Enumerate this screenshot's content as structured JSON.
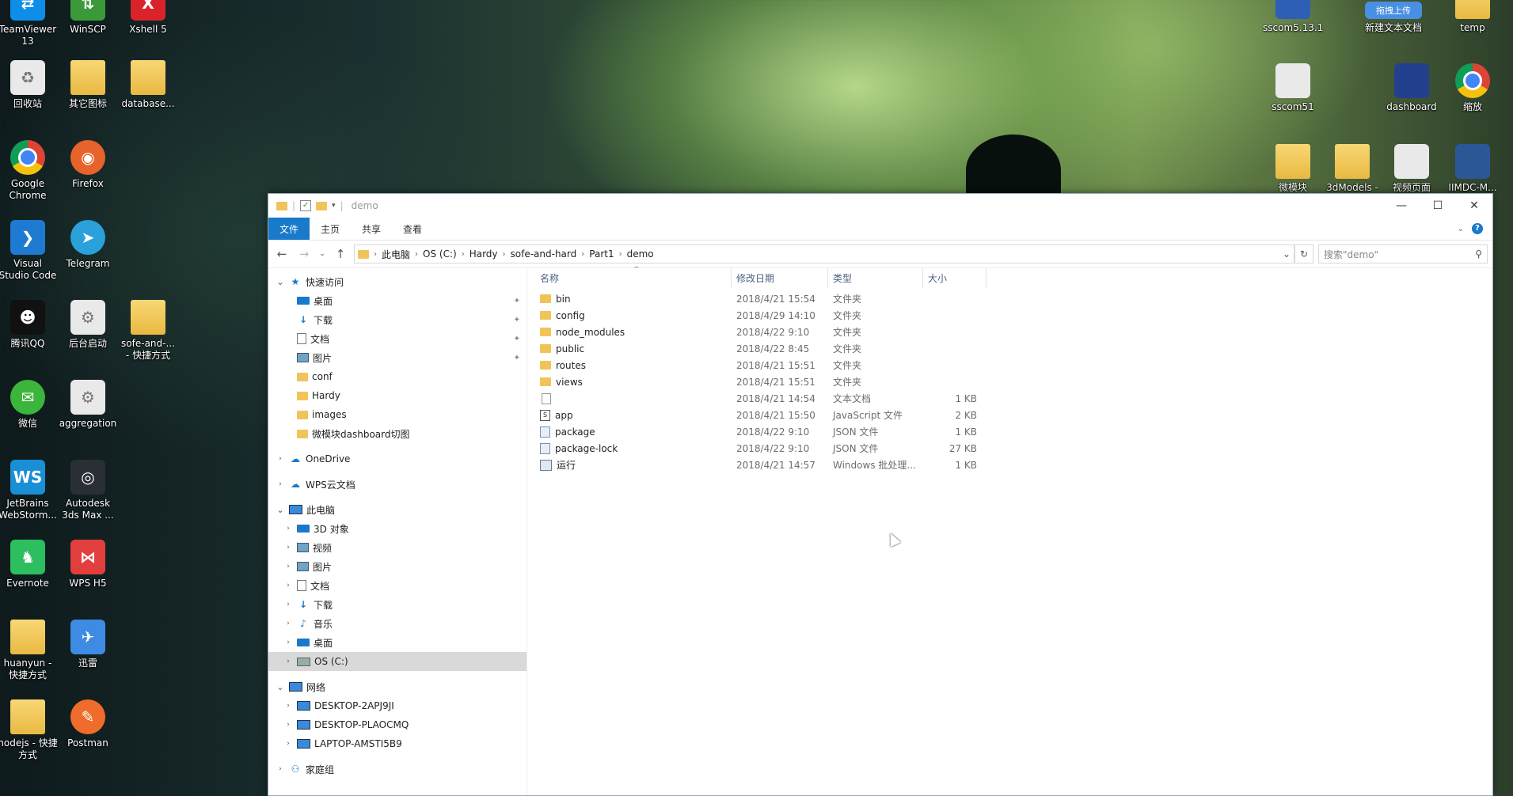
{
  "desktop_left": [
    {
      "label": "TeamViewer 13",
      "icon": "teamviewer-icon",
      "kind": "blue",
      "glyph": "⇄",
      "color": "#0e8ee9"
    },
    {
      "label": "WinSCP",
      "icon": "winscp-icon",
      "kind": "green",
      "glyph": "⇅",
      "color": "#3a9a3a"
    },
    {
      "label": "Xshell 5",
      "icon": "xshell-icon",
      "kind": "red",
      "glyph": "X",
      "color": "#d9232b"
    },
    {
      "label": "回收站",
      "icon": "recycle-bin-icon",
      "kind": "doc",
      "glyph": "♻",
      "color": "#e9e9e9"
    },
    {
      "label": "其它图标",
      "icon": "folder-icon",
      "kind": "folder",
      "glyph": "",
      "color": "#f1c35b"
    },
    {
      "label": "database...",
      "icon": "folder-icon",
      "kind": "folder",
      "glyph": "",
      "color": "#f1c35b"
    },
    {
      "label": "Google Chrome",
      "icon": "chrome-icon",
      "kind": "chrome",
      "glyph": "",
      "color": ""
    },
    {
      "label": "Firefox",
      "icon": "firefox-icon",
      "kind": "ff",
      "glyph": "◉",
      "color": "#e8622b"
    },
    {
      "label": "Visual Studio Code",
      "icon": "vscode-icon",
      "kind": "vs",
      "glyph": "❯",
      "color": "#1e7ad1"
    },
    {
      "label": "Telegram",
      "icon": "telegram-icon",
      "kind": "tg",
      "glyph": "➤",
      "color": "#2aa1da"
    },
    {
      "label": "腾讯QQ",
      "icon": "qq-icon",
      "kind": "qq",
      "glyph": "☻",
      "color": "#111111"
    },
    {
      "label": "后台启动",
      "icon": "gear-file-icon",
      "kind": "doc",
      "glyph": "⚙",
      "color": "#e9e9e9"
    },
    {
      "label": "sofe-and-... - 快捷方式",
      "icon": "folder-shortcut-icon",
      "kind": "folder",
      "glyph": "",
      "color": "#f1c35b"
    },
    {
      "label": "微信",
      "icon": "wechat-icon",
      "kind": "wx",
      "glyph": "✉",
      "color": "#3bb53b"
    },
    {
      "label": "aggregation",
      "icon": "gear-file-icon",
      "kind": "doc",
      "glyph": "⚙",
      "color": "#e9e9e9"
    },
    {
      "label": "JetBrains WebStorm...",
      "icon": "webstorm-icon",
      "kind": "ws",
      "glyph": "WS",
      "color": "#1b8fd6"
    },
    {
      "label": "Autodesk 3ds Max ...",
      "icon": "3dsmax-icon",
      "kind": "max",
      "glyph": "◎",
      "color": "#2a2f35"
    },
    {
      "label": "Evernote",
      "icon": "evernote-icon",
      "kind": "ev",
      "glyph": "♞",
      "color": "#2dbe60"
    },
    {
      "label": "WPS H5",
      "icon": "wps-h5-icon",
      "kind": "wps",
      "glyph": "⋈",
      "color": "#e23e3e"
    },
    {
      "label": "huanyun - 快捷方式",
      "icon": "folder-shortcut-icon",
      "kind": "folder",
      "glyph": "",
      "color": "#f1c35b"
    },
    {
      "label": "迅雷",
      "icon": "xunlei-icon",
      "kind": "xl",
      "glyph": "✈",
      "color": "#3d8be2"
    },
    {
      "label": "nodejs - 快捷方式",
      "icon": "folder-shortcut-icon",
      "kind": "folder",
      "glyph": "",
      "color": "#f1c35b"
    },
    {
      "label": "Postman",
      "icon": "postman-icon",
      "kind": "pm",
      "glyph": "✎",
      "color": "#ef6c2c"
    }
  ],
  "desktop_right": [
    {
      "label": "sscom5.13.1",
      "icon": "sscom-icon",
      "color": "#2d5fb6"
    },
    {
      "label": "新建文本文档",
      "icon": "baidu-upload-icon",
      "color": "#4a90e2",
      "badge": "拖拽上传"
    },
    {
      "label": "temp",
      "icon": "folder-icon",
      "color": "#f1c35b"
    },
    {
      "label": "sscom51",
      "icon": "gear-file-icon",
      "color": "#e9e9e9"
    },
    {
      "label": "dashboard",
      "icon": "dashboard-icon",
      "color": "#23408f"
    },
    {
      "label": "缩放",
      "icon": "chrome-icon",
      "color": ""
    },
    {
      "label": "微模块",
      "icon": "folder-icon",
      "color": "#f1c35b"
    },
    {
      "label": "3dModels -",
      "icon": "folder-shortcut-icon",
      "color": "#f1c35b"
    },
    {
      "label": "视频页面",
      "icon": "video-page-icon",
      "color": "#e9e9e9"
    },
    {
      "label": "IIMDC-M...",
      "icon": "word-doc-icon",
      "color": "#2b5797"
    }
  ],
  "window": {
    "title": "demo",
    "controls": {
      "minimize": "—",
      "maximize": "☐",
      "close": "✕"
    },
    "tabs": [
      "文件",
      "主页",
      "共享",
      "查看"
    ],
    "help": "?",
    "address": {
      "crumbs": [
        "此电脑",
        "OS (C:)",
        "Hardy",
        "sofe-and-hard",
        "Part1",
        "demo"
      ]
    },
    "search_placeholder": "搜索\"demo\""
  },
  "nav": {
    "quick_access": "快速访问",
    "quick_items": [
      {
        "label": "桌面",
        "icon": "desktop-icon",
        "pinned": true
      },
      {
        "label": "下载",
        "icon": "download-icon",
        "pinned": true
      },
      {
        "label": "文档",
        "icon": "documents-icon",
        "pinned": true
      },
      {
        "label": "图片",
        "icon": "pictures-icon",
        "pinned": true
      },
      {
        "label": "conf",
        "icon": "folder-icon",
        "pinned": false
      },
      {
        "label": "Hardy",
        "icon": "folder-icon",
        "pinned": false
      },
      {
        "label": "images",
        "icon": "folder-icon",
        "pinned": false
      },
      {
        "label": "微模块dashboard切图",
        "icon": "folder-icon",
        "pinned": false
      }
    ],
    "onedrive": "OneDrive",
    "wps": "WPS云文档",
    "thispc": "此电脑",
    "pc_items": [
      {
        "label": "3D 对象",
        "icon": "3d-objects-icon"
      },
      {
        "label": "视频",
        "icon": "videos-icon"
      },
      {
        "label": "图片",
        "icon": "pictures-icon"
      },
      {
        "label": "文档",
        "icon": "documents-icon"
      },
      {
        "label": "下载",
        "icon": "download-icon"
      },
      {
        "label": "音乐",
        "icon": "music-icon"
      },
      {
        "label": "桌面",
        "icon": "desktop-icon"
      },
      {
        "label": "OS (C:)",
        "icon": "drive-icon",
        "selected": true
      }
    ],
    "network": "网络",
    "net_items": [
      "DESKTOP-2APJ9JI",
      "DESKTOP-PLAOCMQ",
      "LAPTOP-AMSTI5B9"
    ],
    "homegroup": "家庭组"
  },
  "columns": {
    "name": "名称",
    "date": "修改日期",
    "type": "类型",
    "size": "大小"
  },
  "files": [
    {
      "name": "bin",
      "date": "2018/4/21 15:54",
      "type": "文件夹",
      "size": "",
      "kind": "folder"
    },
    {
      "name": "config",
      "date": "2018/4/29 14:10",
      "type": "文件夹",
      "size": "",
      "kind": "folder"
    },
    {
      "name": "node_modules",
      "date": "2018/4/22 9:10",
      "type": "文件夹",
      "size": "",
      "kind": "folder"
    },
    {
      "name": "public",
      "date": "2018/4/22 8:45",
      "type": "文件夹",
      "size": "",
      "kind": "folder"
    },
    {
      "name": "routes",
      "date": "2018/4/21 15:51",
      "type": "文件夹",
      "size": "",
      "kind": "folder"
    },
    {
      "name": "views",
      "date": "2018/4/21 15:51",
      "type": "文件夹",
      "size": "",
      "kind": "folder"
    },
    {
      "name": "",
      "date": "2018/4/21 14:54",
      "type": "文本文档",
      "size": "1 KB",
      "kind": "text"
    },
    {
      "name": "app",
      "date": "2018/4/21 15:50",
      "type": "JavaScript 文件",
      "size": "2 KB",
      "kind": "js"
    },
    {
      "name": "package",
      "date": "2018/4/22 9:10",
      "type": "JSON 文件",
      "size": "1 KB",
      "kind": "json"
    },
    {
      "name": "package-lock",
      "date": "2018/4/22 9:10",
      "type": "JSON 文件",
      "size": "27 KB",
      "kind": "json"
    },
    {
      "name": "运行",
      "date": "2018/4/21 14:57",
      "type": "Windows 批处理...",
      "size": "1 KB",
      "kind": "bat"
    }
  ]
}
